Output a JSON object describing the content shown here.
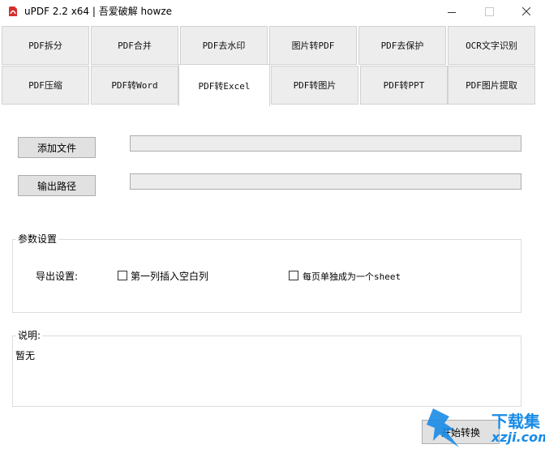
{
  "window": {
    "title": "uPDF 2.2 x64 | 吾爱破解 howze"
  },
  "tabs_row1": [
    "PDF拆分",
    "PDF合并",
    "PDF去水印",
    "图片转PDF",
    "PDF去保护",
    "OCR文字识别"
  ],
  "tabs_row2": [
    "PDF压缩",
    "PDF转Word",
    "PDF转Excel",
    "PDF转图片",
    "PDF转PPT",
    "PDF图片提取"
  ],
  "active_tab": "PDF转Excel",
  "file": {
    "add_button": "添加文件",
    "output_button": "输出路径",
    "file_value": "",
    "output_value": ""
  },
  "params": {
    "group_label": "参数设置",
    "export_label": "导出设置:",
    "option1": "第一列插入空白列",
    "option2": "每页单独成为一个sheet",
    "option1_checked": false,
    "option2_checked": false
  },
  "notes": {
    "label": "说明:",
    "content": "暂无"
  },
  "start_button": "开始转换",
  "watermark_text": "下载集",
  "watermark_sub": "xzji.com",
  "colors": {
    "accent": "#1a8be6",
    "tab_bg": "#ededed",
    "button_bg": "#e1e1e1"
  }
}
